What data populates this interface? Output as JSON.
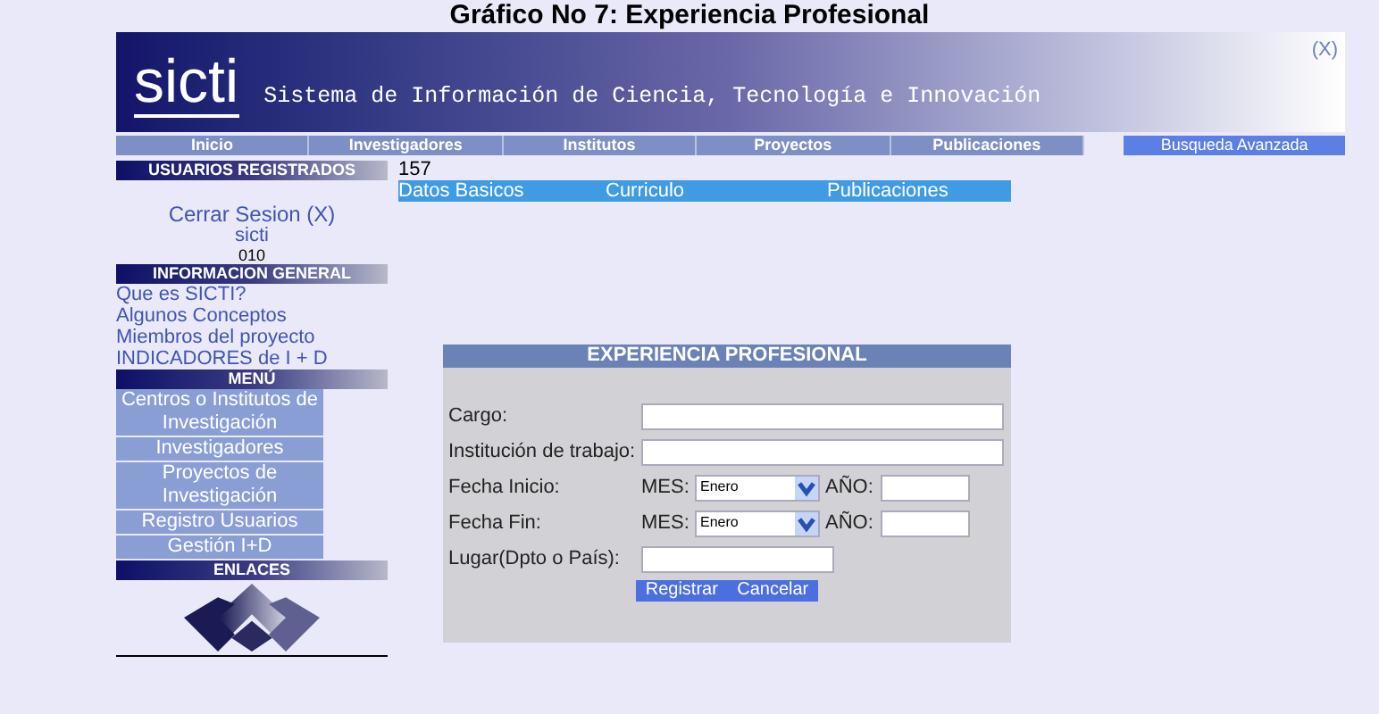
{
  "caption": "Gráfico No 7: Experiencia Profesional",
  "banner": {
    "logo": "sicti",
    "title": "Sistema de Información de Ciencia, Tecnología e Innovación",
    "close": "(X)"
  },
  "nav": [
    {
      "label": "Inicio",
      "selected": false
    },
    {
      "label": "Investigadores",
      "selected": false
    },
    {
      "label": "Institutos",
      "selected": false
    },
    {
      "label": "Proyectos",
      "selected": false
    },
    {
      "label": "Publicaciones",
      "selected": false
    },
    {
      "label": "Busqueda Avanzada",
      "selected": true
    }
  ],
  "sidebar": {
    "users_header": "USUARIOS REGISTRADOS",
    "logout": "Cerrar Sesion (X)",
    "user": "sicti",
    "code": "010",
    "info_header": "INFORMACION GENERAL",
    "info_links": [
      "Que es SICTI?",
      "Algunos Conceptos",
      "Miembros del proyecto",
      "INDICADORES de I + D"
    ],
    "menu_header": "MENÚ",
    "menu_items": [
      "Centros o Institutos de Investigación",
      "Investigadores",
      "Proyectos de Investigación",
      "Registro Usuarios",
      "Gestión I+D"
    ],
    "links_header": "ENLACES"
  },
  "counter": "157",
  "subtabs": [
    "Datos Basicos",
    "Curriculo",
    "Publicaciones"
  ],
  "form": {
    "title": "EXPERIENCIA PROFESIONAL",
    "rows": [
      {
        "kind": "text",
        "label": "Cargo:"
      },
      {
        "kind": "text",
        "label": "Institución de trabajo:"
      },
      {
        "kind": "date",
        "label": "Fecha Inicio:",
        "month_label": "MES:",
        "month": "Enero",
        "year_label": "AÑO:"
      },
      {
        "kind": "date",
        "label": "Fecha Fin:",
        "month_label": "MES:",
        "month": "Enero",
        "year_label": "AÑO:"
      },
      {
        "kind": "short",
        "label": "Lugar(Dpto o País):"
      }
    ],
    "buttons": [
      "Registrar",
      "Cancelar"
    ]
  }
}
